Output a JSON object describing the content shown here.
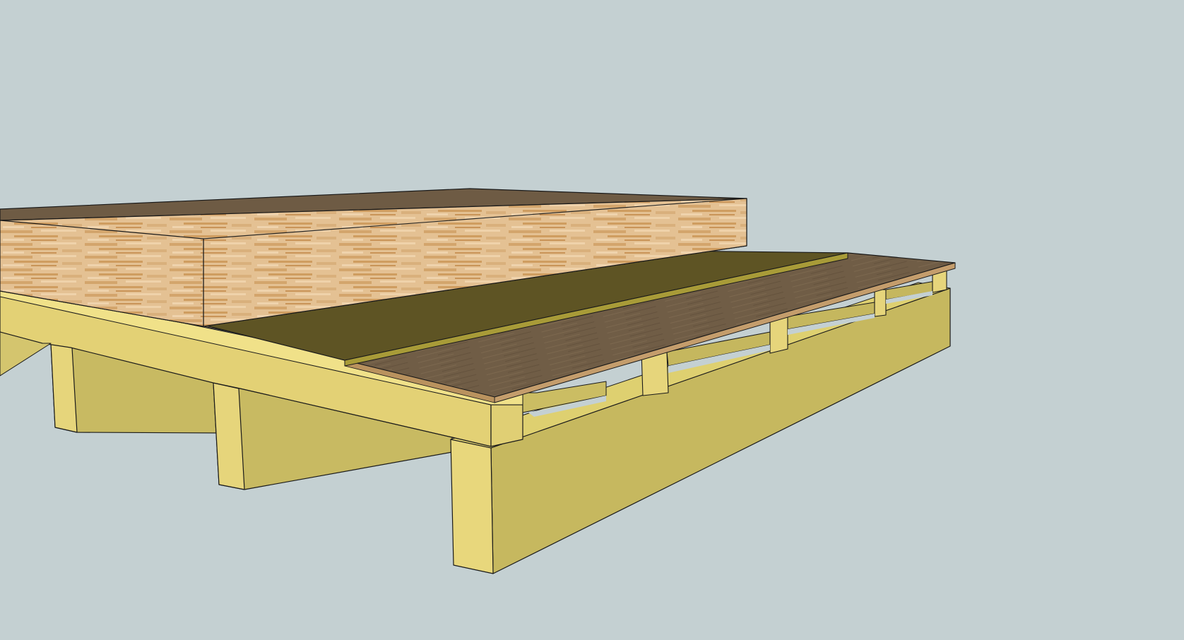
{
  "viewport": {
    "background_color": "#c4d0d2",
    "edge_color": "#1a1a1a"
  },
  "materials": {
    "wood_framing_face": "#e9d87e",
    "wood_framing_front": "#dccd73",
    "wood_framing_side": "#c4b55e",
    "wood_framing_shadow": "#b3a653",
    "subfloor_top": "#73663f",
    "subfloor_edge": "#c69a62",
    "underlayment_top": "#5f5524",
    "underlayment_edge": "#a79b37",
    "hardwood_top": "#6f5c45",
    "hardwood_edge": "#c49d6c",
    "plank_block_top": "#6f5c45",
    "plank_block_face_light": "#e7c59a",
    "plank_block_face_mid": "#d6aa72",
    "plank_block_face_dark": "#c49055"
  }
}
